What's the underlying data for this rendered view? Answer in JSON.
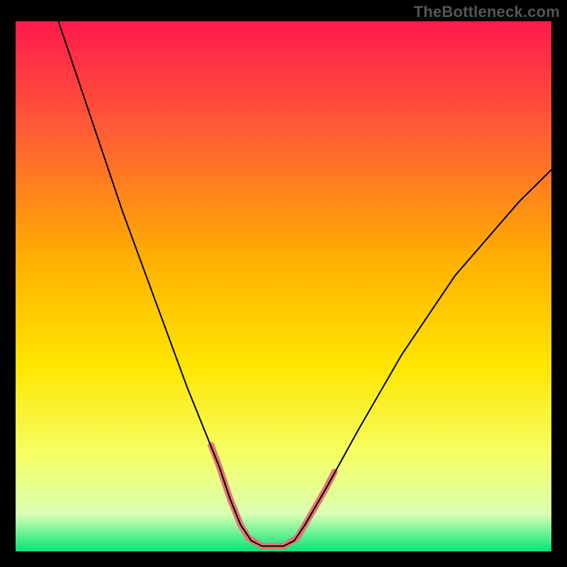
{
  "watermark": "TheBottleneck.com",
  "chart_data": {
    "type": "line",
    "title": "",
    "xlabel": "",
    "ylabel": "",
    "xlim": [
      0,
      100
    ],
    "ylim": [
      0,
      100
    ],
    "gradient_stops": [
      {
        "offset": 0.0,
        "color": "#ff1a4b"
      },
      {
        "offset": 0.2,
        "color": "#ff5a36"
      },
      {
        "offset": 0.45,
        "color": "#ffb000"
      },
      {
        "offset": 0.65,
        "color": "#ffe600"
      },
      {
        "offset": 0.82,
        "color": "#f5ff66"
      },
      {
        "offset": 0.93,
        "color": "#d9ffb3"
      },
      {
        "offset": 1.0,
        "color": "#00e676"
      }
    ],
    "series": [
      {
        "name": "curve",
        "stroke": "#000000",
        "stroke_width": 2,
        "x": [
          8,
          12,
          16,
          20,
          24,
          28,
          32,
          34,
          36,
          38,
          40,
          42,
          44,
          46,
          48,
          50,
          52,
          54,
          58,
          64,
          72,
          82,
          94,
          100
        ],
        "y": [
          100,
          88,
          76,
          64,
          53,
          42,
          31,
          26,
          21,
          16,
          10,
          5,
          2,
          1,
          1,
          1,
          2,
          5,
          12,
          23,
          37,
          52,
          66,
          72
        ]
      }
    ],
    "highlight": {
      "name": "bottom-highlight",
      "stroke": "#e57373",
      "stroke_width": 9,
      "segments": [
        {
          "x": [
            36.5,
            38,
            40,
            42,
            43.5
          ],
          "y": [
            20,
            16,
            10,
            5,
            2.5
          ]
        },
        {
          "x": [
            43.5,
            46,
            48,
            50,
            52.5
          ],
          "y": [
            2.5,
            1,
            1,
            1,
            2.5
          ]
        },
        {
          "x": [
            52.5,
            54,
            56,
            58,
            59.5
          ],
          "y": [
            2.5,
            5,
            8.5,
            12,
            15
          ]
        }
      ]
    }
  }
}
